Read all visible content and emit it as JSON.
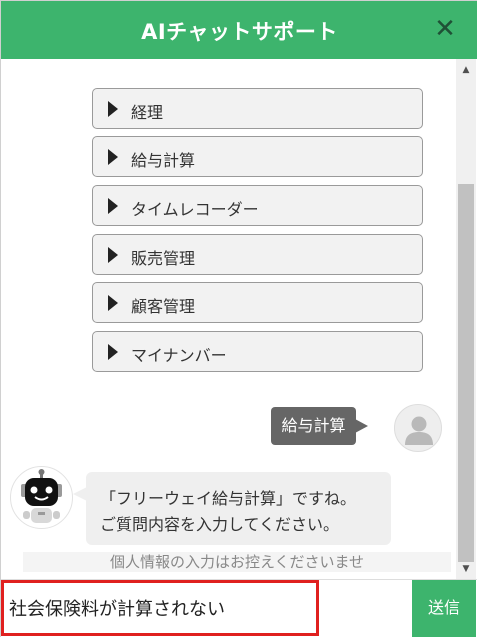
{
  "header": {
    "title": "AIチャットサポート",
    "close_symbol": "✕",
    "color": "#3db46d"
  },
  "menu": {
    "items": [
      {
        "label": "経理",
        "icon": "triangle-right-icon"
      },
      {
        "label": "給与計算",
        "icon": "triangle-right-icon"
      },
      {
        "label": "タイムレコーダー",
        "icon": "triangle-right-icon"
      },
      {
        "label": "販売管理",
        "icon": "triangle-right-icon"
      },
      {
        "label": "顧客管理",
        "icon": "triangle-right-icon"
      },
      {
        "label": "マイナンバー",
        "icon": "triangle-right-icon"
      }
    ]
  },
  "conversation": {
    "user_message": "給与計算",
    "bot_message": {
      "line1": "「フリーウェイ給与計算」ですね。",
      "line2": "ご質問内容を入力してください。"
    }
  },
  "notice": "個人情報の入力はお控えくださいませ",
  "input": {
    "value": "社会保険料が計算されない",
    "send_label": "送信"
  },
  "colors": {
    "accent": "#3db46d",
    "user_bubble": "#666666",
    "bot_bubble": "#efefef",
    "highlight_border": "#e0201f"
  }
}
